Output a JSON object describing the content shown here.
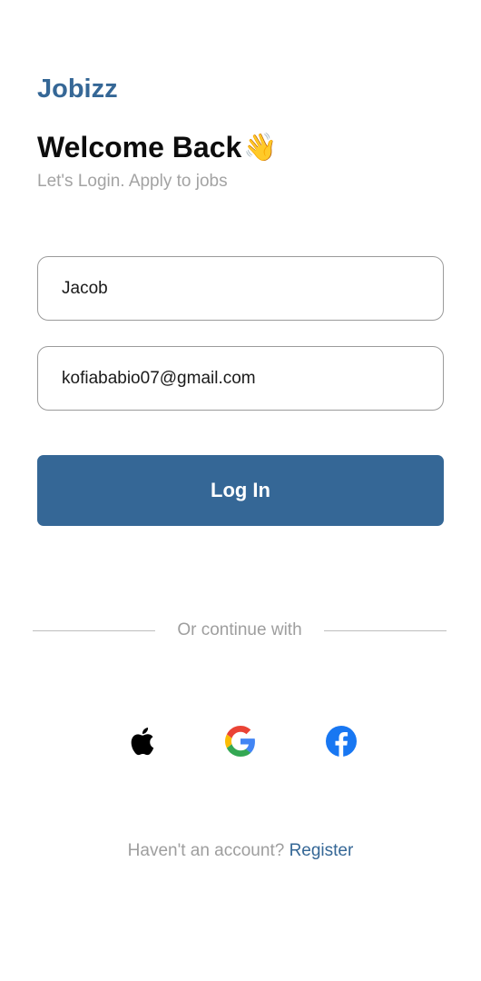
{
  "brand": "Jobizz",
  "header": {
    "title": "Welcome Back",
    "emoji": "👋",
    "subtitle": "Let's Login. Apply to jobs"
  },
  "form": {
    "name_value": "Jacob",
    "email_value": "kofiababio07@gmail.com",
    "login_label": "Log In"
  },
  "divider_text": "Or continue with",
  "social": {
    "icons": [
      "apple-icon",
      "google-icon",
      "facebook-icon"
    ]
  },
  "footer": {
    "prompt": "Haven't an account?",
    "link": "Register"
  },
  "colors": {
    "primary": "#356796",
    "facebook": "#1877F2"
  }
}
